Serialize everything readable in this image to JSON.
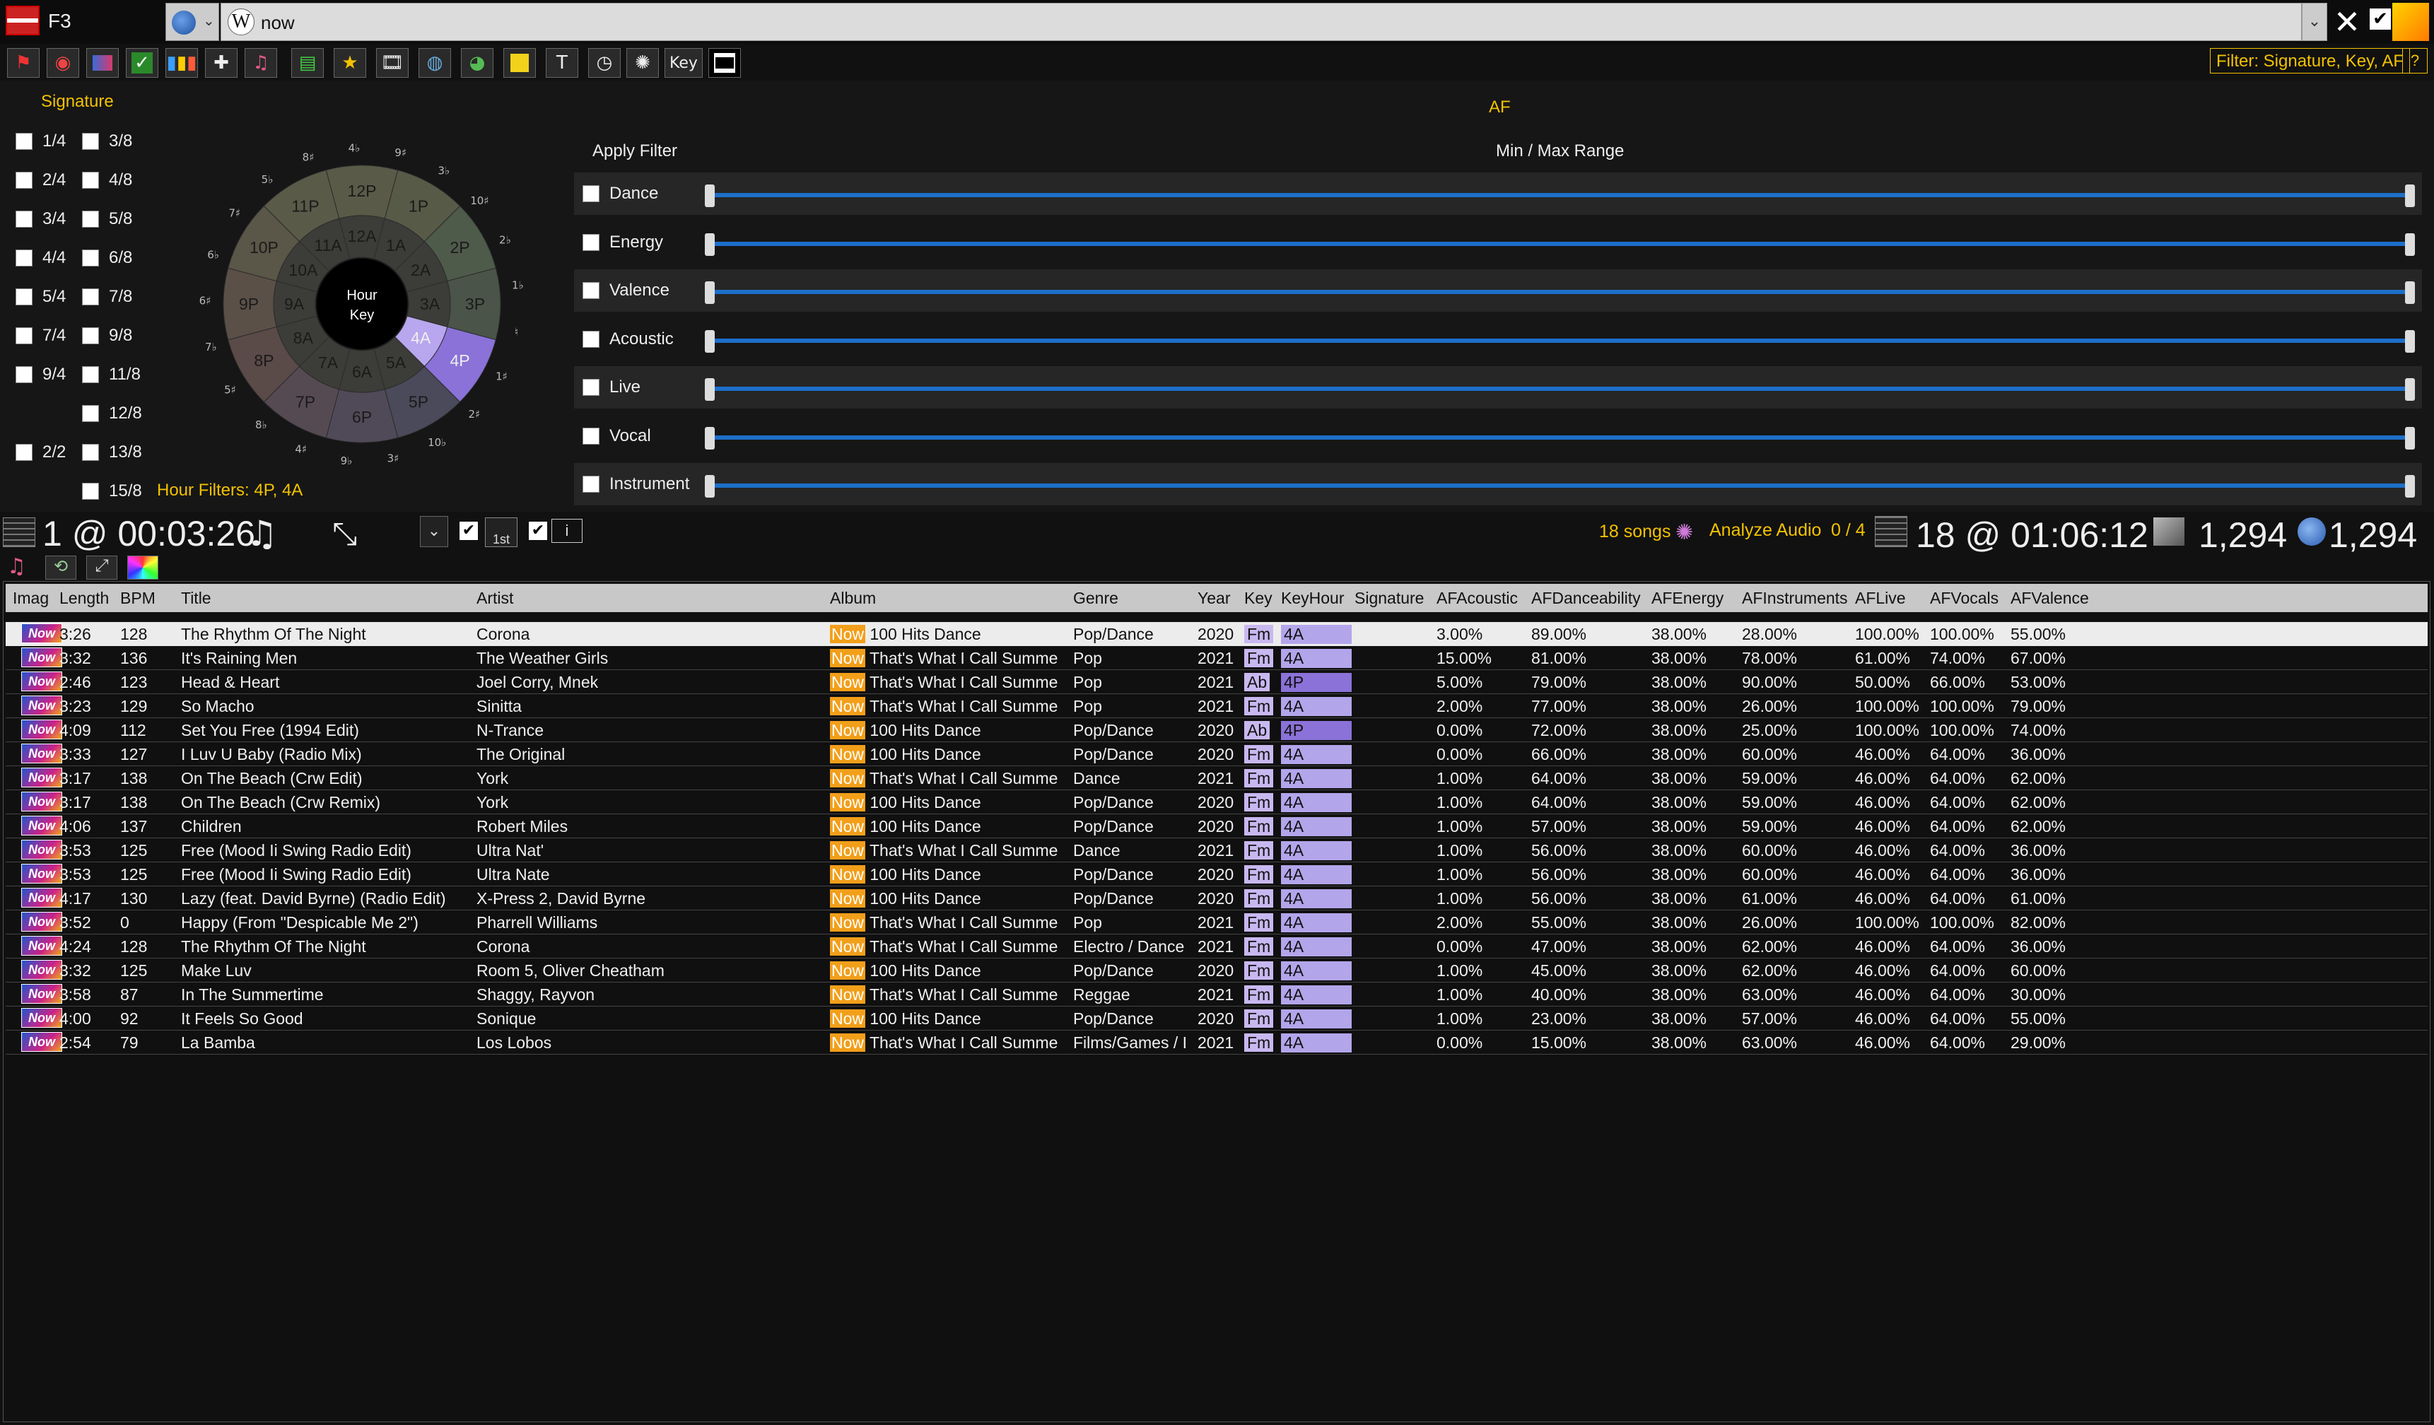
{
  "topbar": {
    "hotkey_label": "F3",
    "search_value": "now",
    "filter_label": "Filter: Signature, Key, AF",
    "help_label": "?"
  },
  "toolbar": {
    "key_label": "Key",
    "icons": [
      "flag-icon",
      "record-icon",
      "palette-icon",
      "check-icon",
      "bar-chart-icon",
      "plus-icon",
      "music-icon",
      "film-strip-icon",
      "star-icon",
      "film-icon",
      "globe-icon",
      "earth-icon",
      "note-icon",
      "text-icon",
      "clock-icon",
      "dots-ring-icon"
    ]
  },
  "signature": {
    "title": "Signature",
    "left_col": [
      "1/4",
      "2/4",
      "3/4",
      "4/4",
      "5/4",
      "7/4",
      "9/4",
      "",
      "2/2"
    ],
    "right_col": [
      "3/8",
      "4/8",
      "5/8",
      "6/8",
      "7/8",
      "9/8",
      "11/8",
      "12/8",
      "13/8",
      "15/8"
    ],
    "hour_filters": "Hour Filters: 4P, 4A"
  },
  "wheel": {
    "center_line1": "Hour",
    "center_line2": "Key",
    "outer": [
      "12P",
      "1P",
      "2P",
      "3P",
      "4P",
      "5P",
      "6P",
      "7P",
      "8P",
      "9P",
      "10P",
      "11P"
    ],
    "inner": [
      "12A",
      "1A",
      "2A",
      "3A",
      "4A",
      "5A",
      "6A",
      "7A",
      "8A",
      "9A",
      "10A",
      "11A"
    ],
    "keys": [
      "8♯",
      "4♭",
      "9♯",
      "3♭",
      "10♯",
      "2♭",
      "1♭",
      "♮",
      "1♯",
      "2♯",
      "10♭",
      "3♯",
      "9♭",
      "4♯",
      "8♭",
      "5♯",
      "7♭",
      "6♯",
      "6♭",
      "7♯",
      "5♭"
    ],
    "selected": [
      "4P",
      "4A"
    ]
  },
  "af": {
    "title": "AF",
    "apply_filter": "Apply Filter",
    "range_label": "Min / Max Range",
    "filters": [
      "Dance",
      "Energy",
      "Valence",
      "Acoustic",
      "Live",
      "Vocal",
      "Instrument"
    ]
  },
  "status": {
    "playing": "1 @ 00:03:26",
    "first_label": "1st",
    "songs_count": "18 songs",
    "analyze": "Analyze Audio",
    "analyze_progress": "0 / 4",
    "total": "18 @ 01:06:12",
    "count1": "1,294",
    "count2": "1,294"
  },
  "columns": [
    "Imag",
    "Length",
    "BPM",
    "Title",
    "Artist",
    "Album",
    "Genre",
    "Year",
    "Key",
    "KeyHour",
    "Signature",
    "AFAcoustic",
    "AFDanceability",
    "AFEnergy",
    "AFInstruments",
    "AFLive",
    "AFVocals",
    "AFValence"
  ],
  "rows": [
    {
      "len": "3:26",
      "bpm": "128",
      "title": "The Rhythm Of The Night",
      "artist": "Corona",
      "album_tag": "Now",
      "album": "100 Hits Dance",
      "genre": "Pop/Dance",
      "year": "2020",
      "key": "Fm",
      "keyhour": "4A",
      "ac": "3.00%",
      "da": "89.00%",
      "en": "38.00%",
      "in": "28.00%",
      "li": "100.00%",
      "vo": "100.00%",
      "va": "55.00%"
    },
    {
      "len": "3:32",
      "bpm": "136",
      "title": "It's Raining Men",
      "artist": "The Weather Girls",
      "album_tag": "Now",
      "album": "That's What I Call Summe",
      "genre": "Pop",
      "year": "2021",
      "key": "Fm",
      "keyhour": "4A",
      "ac": "15.00%",
      "da": "81.00%",
      "en": "38.00%",
      "in": "78.00%",
      "li": "61.00%",
      "vo": "74.00%",
      "va": "67.00%"
    },
    {
      "len": "2:46",
      "bpm": "123",
      "title": "Head & Heart",
      "artist": "Joel Corry, Mnek",
      "album_tag": "Now",
      "album": "That's What I Call Summe",
      "genre": "Pop",
      "year": "2021",
      "key": "Ab",
      "keyhour": "4P",
      "ac": "5.00%",
      "da": "79.00%",
      "en": "38.00%",
      "in": "90.00%",
      "li": "50.00%",
      "vo": "66.00%",
      "va": "53.00%"
    },
    {
      "len": "3:23",
      "bpm": "129",
      "title": "So Macho",
      "artist": "Sinitta",
      "album_tag": "Now",
      "album": "That's What I Call Summe",
      "genre": "Pop",
      "year": "2021",
      "key": "Fm",
      "keyhour": "4A",
      "ac": "2.00%",
      "da": "77.00%",
      "en": "38.00%",
      "in": "26.00%",
      "li": "100.00%",
      "vo": "100.00%",
      "va": "79.00%"
    },
    {
      "len": "4:09",
      "bpm": "112",
      "title": "Set You Free (1994 Edit)",
      "artist": "N-Trance",
      "album_tag": "Now",
      "album": "100 Hits Dance",
      "genre": "Pop/Dance",
      "year": "2020",
      "key": "Ab",
      "keyhour": "4P",
      "ac": "0.00%",
      "da": "72.00%",
      "en": "38.00%",
      "in": "25.00%",
      "li": "100.00%",
      "vo": "100.00%",
      "va": "74.00%"
    },
    {
      "len": "3:33",
      "bpm": "127",
      "title": "I Luv U Baby (Radio Mix)",
      "artist": "The Original",
      "album_tag": "Now",
      "album": "100 Hits Dance",
      "genre": "Pop/Dance",
      "year": "2020",
      "key": "Fm",
      "keyhour": "4A",
      "ac": "0.00%",
      "da": "66.00%",
      "en": "38.00%",
      "in": "60.00%",
      "li": "46.00%",
      "vo": "64.00%",
      "va": "36.00%"
    },
    {
      "len": "3:17",
      "bpm": "138",
      "title": "On The Beach (Crw Edit)",
      "artist": "York",
      "album_tag": "Now",
      "album": "That's What I Call Summe",
      "genre": "Dance",
      "year": "2021",
      "key": "Fm",
      "keyhour": "4A",
      "ac": "1.00%",
      "da": "64.00%",
      "en": "38.00%",
      "in": "59.00%",
      "li": "46.00%",
      "vo": "64.00%",
      "va": "62.00%"
    },
    {
      "len": "3:17",
      "bpm": "138",
      "title": "On The Beach (Crw Remix)",
      "artist": "York",
      "album_tag": "Now",
      "album": "100 Hits Dance",
      "genre": "Pop/Dance",
      "year": "2020",
      "key": "Fm",
      "keyhour": "4A",
      "ac": "1.00%",
      "da": "64.00%",
      "en": "38.00%",
      "in": "59.00%",
      "li": "46.00%",
      "vo": "64.00%",
      "va": "62.00%"
    },
    {
      "len": "4:06",
      "bpm": "137",
      "title": "Children",
      "artist": "Robert Miles",
      "album_tag": "Now",
      "album": "100 Hits Dance",
      "genre": "Pop/Dance",
      "year": "2020",
      "key": "Fm",
      "keyhour": "4A",
      "ac": "1.00%",
      "da": "57.00%",
      "en": "38.00%",
      "in": "59.00%",
      "li": "46.00%",
      "vo": "64.00%",
      "va": "62.00%"
    },
    {
      "len": "3:53",
      "bpm": "125",
      "title": "Free (Mood Ii Swing Radio Edit)",
      "artist": "Ultra Nat'",
      "album_tag": "Now",
      "album": "That's What I Call Summe",
      "genre": "Dance",
      "year": "2021",
      "key": "Fm",
      "keyhour": "4A",
      "ac": "1.00%",
      "da": "56.00%",
      "en": "38.00%",
      "in": "60.00%",
      "li": "46.00%",
      "vo": "64.00%",
      "va": "36.00%"
    },
    {
      "len": "3:53",
      "bpm": "125",
      "title": "Free (Mood Ii Swing Radio Edit)",
      "artist": "Ultra Nate",
      "album_tag": "Now",
      "album": "100 Hits Dance",
      "genre": "Pop/Dance",
      "year": "2020",
      "key": "Fm",
      "keyhour": "4A",
      "ac": "1.00%",
      "da": "56.00%",
      "en": "38.00%",
      "in": "60.00%",
      "li": "46.00%",
      "vo": "64.00%",
      "va": "36.00%"
    },
    {
      "len": "4:17",
      "bpm": "130",
      "title": "Lazy (feat. David Byrne) (Radio Edit)",
      "artist": "X-Press 2, David Byrne",
      "album_tag": "Now",
      "album": "100 Hits Dance",
      "genre": "Pop/Dance",
      "year": "2020",
      "key": "Fm",
      "keyhour": "4A",
      "ac": "1.00%",
      "da": "56.00%",
      "en": "38.00%",
      "in": "61.00%",
      "li": "46.00%",
      "vo": "64.00%",
      "va": "61.00%"
    },
    {
      "len": "3:52",
      "bpm": "0",
      "title": "Happy (From \"Despicable Me 2\")",
      "artist": "Pharrell Williams",
      "album_tag": "Now",
      "album": "That's What I Call Summe",
      "genre": "Pop",
      "year": "2021",
      "key": "Fm",
      "keyhour": "4A",
      "ac": "2.00%",
      "da": "55.00%",
      "en": "38.00%",
      "in": "26.00%",
      "li": "100.00%",
      "vo": "100.00%",
      "va": "82.00%"
    },
    {
      "len": "4:24",
      "bpm": "128",
      "title": "The Rhythm Of The Night",
      "artist": "Corona",
      "album_tag": "Now",
      "album": "That's What I Call Summe",
      "genre": "Electro / Dance",
      "year": "2021",
      "key": "Fm",
      "keyhour": "4A",
      "ac": "0.00%",
      "da": "47.00%",
      "en": "38.00%",
      "in": "62.00%",
      "li": "46.00%",
      "vo": "64.00%",
      "va": "36.00%"
    },
    {
      "len": "3:32",
      "bpm": "125",
      "title": "Make Luv",
      "artist": "Room 5, Oliver Cheatham",
      "album_tag": "Now",
      "album": "100 Hits Dance",
      "genre": "Pop/Dance",
      "year": "2020",
      "key": "Fm",
      "keyhour": "4A",
      "ac": "1.00%",
      "da": "45.00%",
      "en": "38.00%",
      "in": "62.00%",
      "li": "46.00%",
      "vo": "64.00%",
      "va": "60.00%"
    },
    {
      "len": "3:58",
      "bpm": "87",
      "title": "In The Summertime",
      "artist": "Shaggy, Rayvon",
      "album_tag": "Now",
      "album": "That's What I Call Summe",
      "genre": "Reggae",
      "year": "2021",
      "key": "Fm",
      "keyhour": "4A",
      "ac": "1.00%",
      "da": "40.00%",
      "en": "38.00%",
      "in": "63.00%",
      "li": "46.00%",
      "vo": "64.00%",
      "va": "30.00%"
    },
    {
      "len": "4:00",
      "bpm": "92",
      "title": "It Feels So Good",
      "artist": "Sonique",
      "album_tag": "Now",
      "album": "100 Hits Dance",
      "genre": "Pop/Dance",
      "year": "2020",
      "key": "Fm",
      "keyhour": "4A",
      "ac": "1.00%",
      "da": "23.00%",
      "en": "38.00%",
      "in": "57.00%",
      "li": "46.00%",
      "vo": "64.00%",
      "va": "55.00%"
    },
    {
      "len": "2:54",
      "bpm": "79",
      "title": "La Bamba",
      "artist": "Los Lobos",
      "album_tag": "Now",
      "album": "That's What I Call Summe",
      "genre": "Films/Games / I",
      "year": "2021",
      "key": "Fm",
      "keyhour": "4A",
      "ac": "0.00%",
      "da": "15.00%",
      "en": "38.00%",
      "in": "63.00%",
      "li": "46.00%",
      "vo": "64.00%",
      "va": "29.00%"
    }
  ],
  "thumb_label": "Now",
  "colors": {
    "accent": "#f2c200",
    "slider": "#1d6fc9",
    "now_tag": "#f29f1a",
    "key_cell": "#c8b8f0",
    "wheel_highlight": "#8a72d8"
  }
}
